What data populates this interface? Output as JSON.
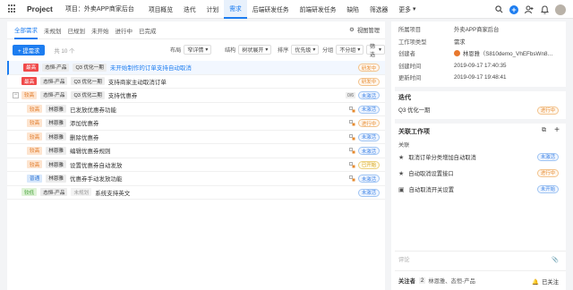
{
  "app": {
    "brand": "Project",
    "project": "项目：外卖APP商家后台"
  },
  "nav": [
    "项目概览",
    "迭代",
    "计划",
    "需求",
    "后端研发任务",
    "前端研发任务",
    "缺陷",
    "筛选器",
    "更多"
  ],
  "nav_active": 3,
  "subtabs": [
    "全部需求",
    "未规划",
    "已规划",
    "未开始",
    "进行中",
    "已完成"
  ],
  "subtab_active": 0,
  "view_manage": "视图管理",
  "toolbar": {
    "new_label": "+ 提需求",
    "count": "共 10 个",
    "layout_label": "布局",
    "layout_value": "窄详情",
    "structure_label": "结构",
    "structure_value": "树状展开",
    "sort_label": "排序",
    "sort_value": "优先级",
    "group_label": "分组",
    "group_value": "不分组",
    "filter_label": "筛选"
  },
  "rows": [
    {
      "priority": "最高",
      "priority_color": "red",
      "owner": "态恒-产品",
      "iteration": "Q3 优化一期",
      "title": "未开始制作的订单支持自动取消",
      "status": "研发中",
      "status_color": "orange",
      "selected": true
    },
    {
      "priority": "最高",
      "priority_color": "red",
      "owner": "态恒-产品",
      "iteration": "Q3 优化一期",
      "title": "支持商家主动取消订单",
      "status": "研发中",
      "status_color": "orange"
    },
    {
      "priority": "较高",
      "priority_color": "orange",
      "owner": "态恒-产品",
      "iteration": "Q3 优化二期",
      "title": "支持优惠券",
      "status": "未激活",
      "status_color": "blue",
      "count": "0/6",
      "parent": true
    },
    {
      "priority": "较高",
      "priority_color": "orange",
      "owner": "林恩雅",
      "title": "已发放优惠券功能",
      "status": "未激活",
      "status_color": "blue",
      "child": true
    },
    {
      "priority": "较高",
      "priority_color": "orange",
      "owner": "林恩雅",
      "title": "添加优惠券",
      "status": "进行中",
      "status_color": "orange",
      "child": true
    },
    {
      "priority": "较高",
      "priority_color": "orange",
      "owner": "林恩雅",
      "title": "删除优惠券",
      "status": "未激活",
      "status_color": "blue",
      "child": true
    },
    {
      "priority": "较高",
      "priority_color": "orange",
      "owner": "林恩雅",
      "title": "编辑优惠券规则",
      "status": "未激活",
      "status_color": "blue",
      "child": true
    },
    {
      "priority": "较高",
      "priority_color": "orange",
      "owner": "林恩雅",
      "title": "设置优惠券自动发放",
      "status": "已开始",
      "status_color": "gold",
      "child": true
    },
    {
      "priority": "普通",
      "priority_color": "blue",
      "owner": "林恩雅",
      "title": "优惠券手动发放功能",
      "status": "未激活",
      "status_color": "blue",
      "child": true
    },
    {
      "priority": "较低",
      "priority_color": "green",
      "owner": "态恒-产品",
      "iteration": "未规划",
      "title": "系统支持英文",
      "status": "未激活",
      "status_color": "blue"
    }
  ],
  "detail": {
    "fields": [
      {
        "k": "所属项目",
        "v": "外卖APP商家后台"
      },
      {
        "k": "工作项类型",
        "v": "需求"
      },
      {
        "k": "创建者",
        "v": "林恩雅（S810demo_VhEFbsWn8…"
      },
      {
        "k": "创建时间",
        "v": "2019-09-17 17:40:35"
      },
      {
        "k": "更新时间",
        "v": "2019-09-17 19:48:41"
      }
    ],
    "iteration_title": "迭代",
    "iteration_value": "Q3 优化一期",
    "iteration_status": "进行中",
    "related_title": "关联工作项",
    "related_label": "关联",
    "related": [
      {
        "title": "取消订单分类增加自动取消",
        "status": "未激活",
        "status_color": "blue"
      },
      {
        "title": "自动取消设置接口",
        "status": "进行中",
        "status_color": "orange"
      },
      {
        "title": "自动取消开关设置",
        "status": "未开始",
        "status_color": "blue"
      }
    ],
    "comment_placeholder": "评论",
    "followers_label": "关注者",
    "followers_count": "2",
    "followers_names": "林恩雅、态恒-产品",
    "followed_label": "已关注"
  }
}
